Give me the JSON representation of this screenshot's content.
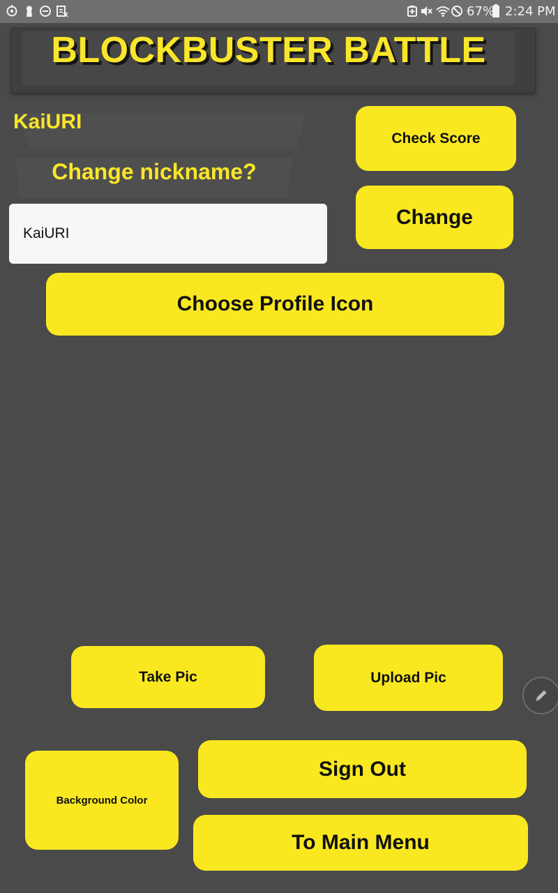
{
  "status_bar": {
    "battery_percent": "67%",
    "time": "2:24 PM",
    "left_icons": [
      "sync-icon",
      "keyhole-icon",
      "do-not-disturb-icon",
      "clipboard-icon"
    ],
    "right_icons": [
      "battery-saver-icon",
      "mute-icon",
      "wifi-icon",
      "blocked-icon",
      "battery-icon"
    ]
  },
  "header": {
    "title": "BLOCKBUSTER BATTLE"
  },
  "profile": {
    "nickname": "KaiURI",
    "change_prompt": "Change nickname?",
    "nickname_input_value": "KaiURI"
  },
  "buttons": {
    "check_score": "Check Score",
    "change": "Change",
    "choose_profile_icon": "Choose Profile Icon",
    "take_pic": "Take Pic",
    "upload_pic": "Upload Pic",
    "background_color": "Background Color",
    "sign_out": "Sign Out",
    "to_main_menu": "To Main Menu"
  },
  "floating_action": {
    "icon": "pencil-icon"
  },
  "colors": {
    "background": "#4a4a4a",
    "accent_yellow": "#f9e820",
    "status_bar": "#6f6f6f"
  }
}
